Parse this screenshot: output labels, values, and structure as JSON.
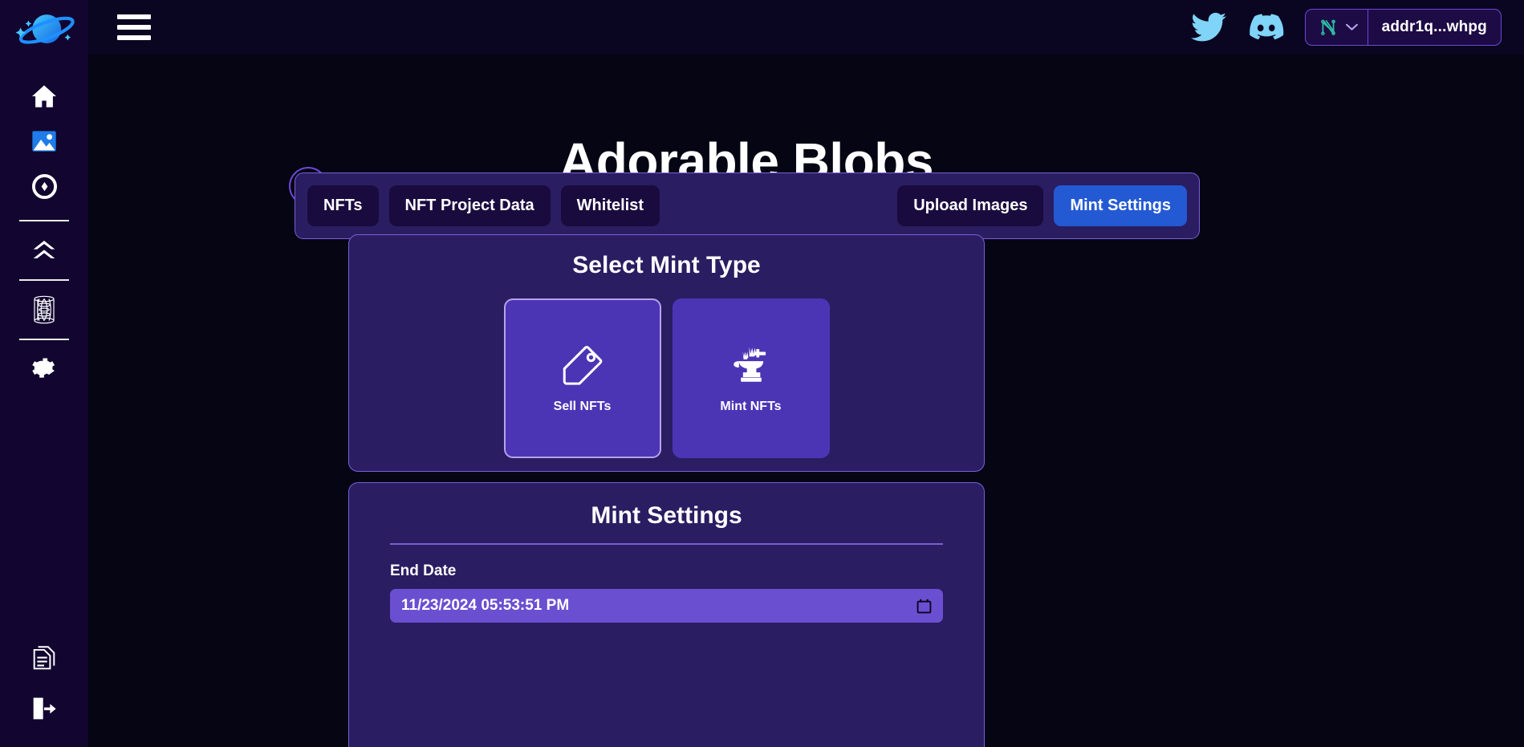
{
  "app": {
    "logo_icon": "planet-logo-icon",
    "background": "#050513",
    "sidebar_background": "#120630",
    "accent_purple": "#6d48d7",
    "tile_purple": "#4c35b5",
    "primary_blue": "#2459d4",
    "panel_purple": "#2a1d62"
  },
  "sidebar": {
    "items": [
      {
        "name": "sidebar-item-home",
        "icon": "home-icon"
      },
      {
        "name": "sidebar-item-gallery",
        "icon": "image-icon"
      },
      {
        "name": "sidebar-item-token",
        "icon": "coin-target-icon"
      },
      {
        "name": "sidebar-item-boost",
        "icon": "double-chevron-up-icon"
      },
      {
        "name": "sidebar-item-portal",
        "icon": "wormhole-icon"
      },
      {
        "name": "sidebar-item-settings",
        "icon": "gear-icon"
      }
    ],
    "bottom_items": [
      {
        "name": "sidebar-item-docs",
        "icon": "documents-icon"
      },
      {
        "name": "sidebar-item-logout",
        "icon": "logout-icon"
      }
    ]
  },
  "topbar": {
    "menu_icon": "hamburger-menu-icon",
    "social": [
      {
        "name": "twitter-link",
        "icon": "twitter-icon"
      },
      {
        "name": "discord-link",
        "icon": "discord-icon"
      }
    ],
    "wallet": {
      "wallet_icon": "nami-wallet-icon",
      "chevron_icon": "chevron-down-icon",
      "address": "addr1q...whpg"
    }
  },
  "page": {
    "back_icon": "arrow-left-circle-icon",
    "title": "Adorable Blobs"
  },
  "tabs": {
    "left": [
      {
        "label": "NFTs"
      },
      {
        "label": "NFT Project Data"
      },
      {
        "label": "Whitelist"
      }
    ],
    "right": [
      {
        "label": "Upload Images",
        "active": false
      },
      {
        "label": "Mint Settings",
        "active": true
      }
    ]
  },
  "mint_type": {
    "title": "Select Mint Type",
    "options": [
      {
        "label": "Sell NFTs",
        "icon": "price-tag-icon",
        "selected": true
      },
      {
        "label": "Mint NFTs",
        "icon": "anvil-icon",
        "selected": false
      }
    ]
  },
  "mint_settings": {
    "title": "Mint Settings",
    "end_date_label": "End Date",
    "end_date_value": "11/23/2024 05:53:51 PM",
    "calendar_icon": "calendar-icon"
  }
}
